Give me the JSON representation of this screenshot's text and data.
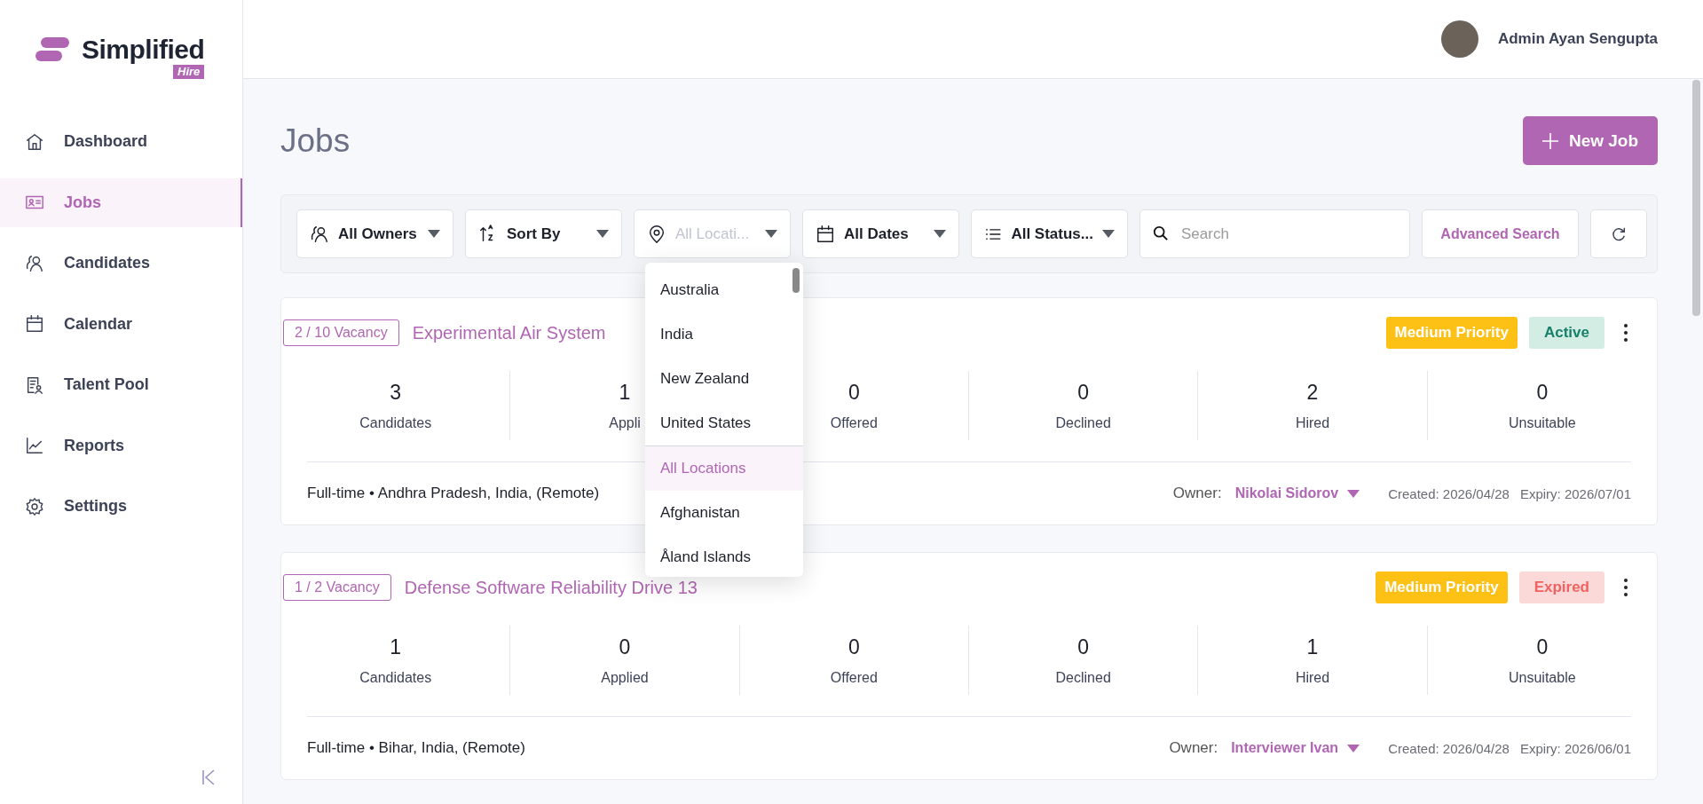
{
  "brand": {
    "name": "Simplified",
    "tag": "Hire"
  },
  "sidebar": {
    "items": [
      {
        "label": "Dashboard",
        "selected": false
      },
      {
        "label": "Jobs",
        "selected": true
      },
      {
        "label": "Candidates",
        "selected": false
      },
      {
        "label": "Calendar",
        "selected": false
      },
      {
        "label": "Talent Pool",
        "selected": false
      },
      {
        "label": "Reports",
        "selected": false
      },
      {
        "label": "Settings",
        "selected": false
      }
    ]
  },
  "header": {
    "user_name": "Admin Ayan Sengupta"
  },
  "page": {
    "title": "Jobs",
    "new_button": "New Job"
  },
  "filters": [
    {
      "label": "All Owners",
      "expanded": false
    },
    {
      "label": "Sort By",
      "expanded": false
    },
    {
      "label": "All Locati...",
      "expanded": true
    },
    {
      "label": "All Dates",
      "expanded": false
    },
    {
      "label": "All Status...",
      "expanded": false
    }
  ],
  "search": {
    "placeholder": "Search"
  },
  "advanced_search": "Advanced Search",
  "location_dropdown": {
    "pinned": [
      {
        "label": "Australia",
        "selected": false
      },
      {
        "label": "India",
        "selected": false
      },
      {
        "label": "New Zealand",
        "selected": false
      },
      {
        "label": "United States",
        "selected": false
      }
    ],
    "items": [
      {
        "label": "All Locations",
        "selected": true
      },
      {
        "label": "Afghanistan",
        "selected": false
      },
      {
        "label": "Åland Islands",
        "selected": false
      }
    ]
  },
  "jobs": [
    {
      "vacancy": "2 / 10 Vacancy",
      "title": "Experimental Air System",
      "priority": "Medium Priority",
      "status": {
        "label": "Active",
        "kind": "active"
      },
      "stats": [
        {
          "value": "3",
          "label": "Candidates"
        },
        {
          "value": "1",
          "label": "Appli"
        },
        {
          "value": "0",
          "label": "Offered"
        },
        {
          "value": "0",
          "label": "Declined"
        },
        {
          "value": "2",
          "label": "Hired"
        },
        {
          "value": "0",
          "label": "Unsuitable"
        }
      ],
      "summary": "Full-time • Andhra Pradesh, India, (Remote)",
      "owner_label": "Owner:",
      "owner": "Nikolai Sidorov",
      "created": "Created: 2026/04/28",
      "expiry": "Expiry: 2026/07/01"
    },
    {
      "vacancy": "1 / 2 Vacancy",
      "title": "Defense Software Reliability Drive 13",
      "priority": "Medium Priority",
      "status": {
        "label": "Expired",
        "kind": "expired"
      },
      "stats": [
        {
          "value": "1",
          "label": "Candidates"
        },
        {
          "value": "0",
          "label": "Applied"
        },
        {
          "value": "0",
          "label": "Offered"
        },
        {
          "value": "0",
          "label": "Declined"
        },
        {
          "value": "1",
          "label": "Hired"
        },
        {
          "value": "0",
          "label": "Unsuitable"
        }
      ],
      "summary": "Full-time • Bihar, India, (Remote)",
      "owner_label": "Owner:",
      "owner": "Interviewer Ivan",
      "created": "Created: 2026/04/28",
      "expiry": "Expiry: 2026/06/01"
    }
  ]
}
